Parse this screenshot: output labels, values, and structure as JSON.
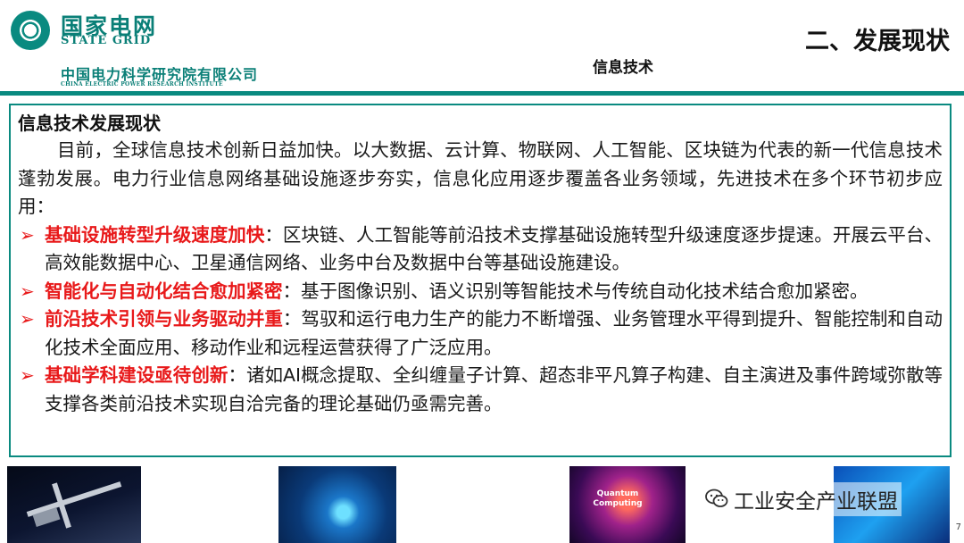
{
  "header": {
    "logo_cn": "国家电网",
    "logo_en": "STATE GRID",
    "institute_cn": "中国电力科学研究院有限公司",
    "institute_en": "CHINA ELECTRIC POWER RESEARCH INSTITUTE",
    "section_title": "二、发展现状",
    "sub_title": "信息技术"
  },
  "content": {
    "heading": "信息技术发展现状",
    "intro": "目前，全球信息技术创新日益加快。以大数据、云计算、物联网、人工智能、区块链为代表的新一代信息技术蓬勃发展。电力行业信息网络基础设施逐步夯实，信息化应用逐步覆盖各业务领域，先进技术在多个环节初步应用：",
    "bullets": [
      {
        "title": "基础设施转型升级速度加快",
        "text": "：区块链、人工智能等前沿技术支撑基础设施转型升级速度逐步提速。开展云平台、高效能数据中心、卫星通信网络、业务中台及数据中台等基础设施建设。"
      },
      {
        "title": "智能化与自动化结合愈加紧密",
        "text": "：基于图像识别、语义识别等智能技术与传统自动化技术结合愈加紧密。"
      },
      {
        "title": "前沿技术引领与业务驱动并重",
        "text": "：驾驭和运行电力生产的能力不断增强、业务管理水平得到提升、智能控制和自动化技术全面应用、移动作业和远程运营获得了广泛应用。"
      },
      {
        "title": "基础学科建设亟待创新",
        "text": "：诸如AI概念提取、全纠缠量子计算、超态非平凡算子构建、自主演进及事件跨域弥散等支撑各类前沿技术实现自洽完备的理论基础仍亟需完善。"
      }
    ]
  },
  "images": {
    "quantum_label": "Quantum Computing"
  },
  "footer": {
    "watermark": "工业安全产业联盟",
    "page_number": "7"
  },
  "colors": {
    "brand": "#0a8a80",
    "highlight": "#e8191a"
  }
}
